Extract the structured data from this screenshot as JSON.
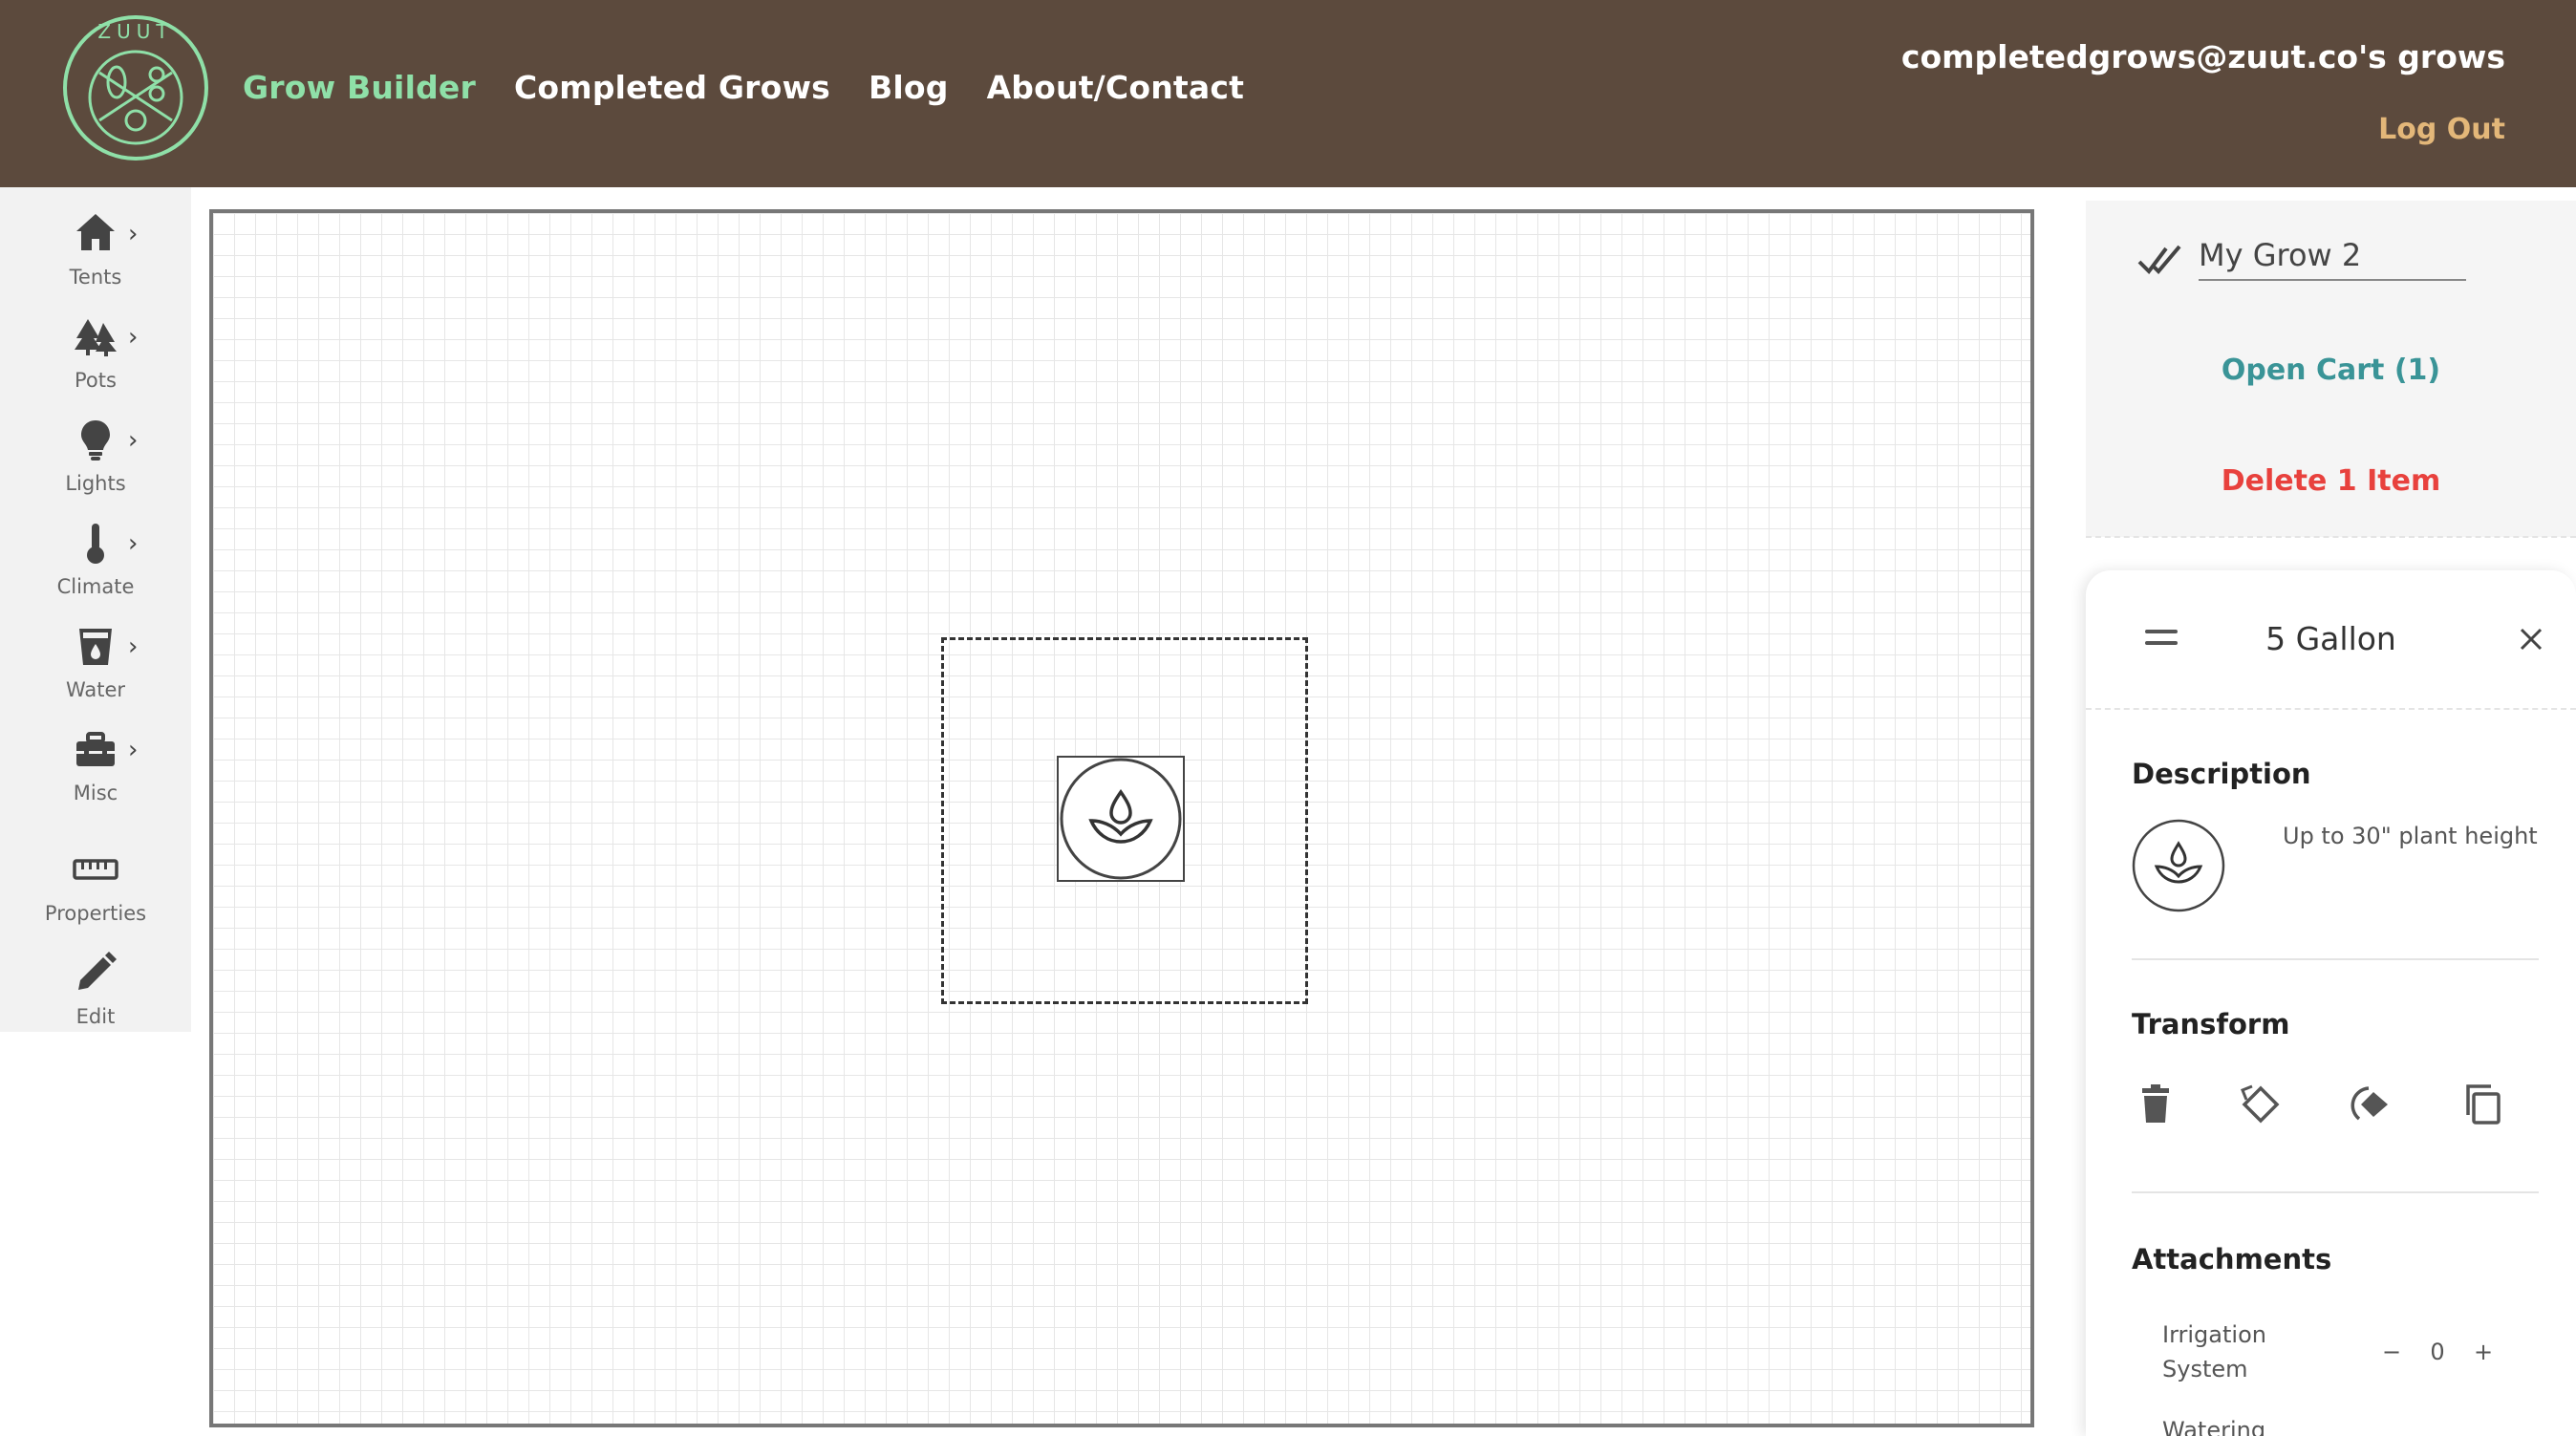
{
  "nav": {
    "logo_text": "ZUUT",
    "links": [
      "Grow Builder",
      "Completed Grows",
      "Blog",
      "About/Contact"
    ],
    "user_label": "completedgrows@zuut.co's grows",
    "logout": "Log Out",
    "colors": {
      "bar": "#5c4a3d",
      "active_link": "#8fe0a8",
      "logout": "#e3b779"
    }
  },
  "toolbar": {
    "items": [
      {
        "label": "Tents",
        "icon": "home-icon"
      },
      {
        "label": "Pots",
        "icon": "trees-icon"
      },
      {
        "label": "Lights",
        "icon": "bulb-icon"
      },
      {
        "label": "Climate",
        "icon": "thermometer-icon"
      },
      {
        "label": "Water",
        "icon": "cup-icon"
      },
      {
        "label": "Misc",
        "icon": "toolbox-icon"
      },
      {
        "label": "Properties",
        "icon": "ruler-icon"
      },
      {
        "label": "Edit",
        "icon": "pencil-icon"
      }
    ]
  },
  "grow": {
    "name": "My Grow 2",
    "open_cart": "Open Cart (1)",
    "delete": "Delete 1 Item"
  },
  "item_panel": {
    "title": "5 Gallon",
    "description_title": "Description",
    "description": "Up to 30\" plant height",
    "transform_title": "Transform",
    "transform_actions": [
      "trash-icon",
      "rotate-left-icon",
      "rotate-right-icon",
      "copy-icon"
    ],
    "attachments_title": "Attachments",
    "attachments": [
      {
        "label_line1": "Irrigation",
        "label_line2": "System",
        "minus": "−",
        "count": "0",
        "plus": "+"
      }
    ],
    "next_attachment_partial": "Watering"
  }
}
